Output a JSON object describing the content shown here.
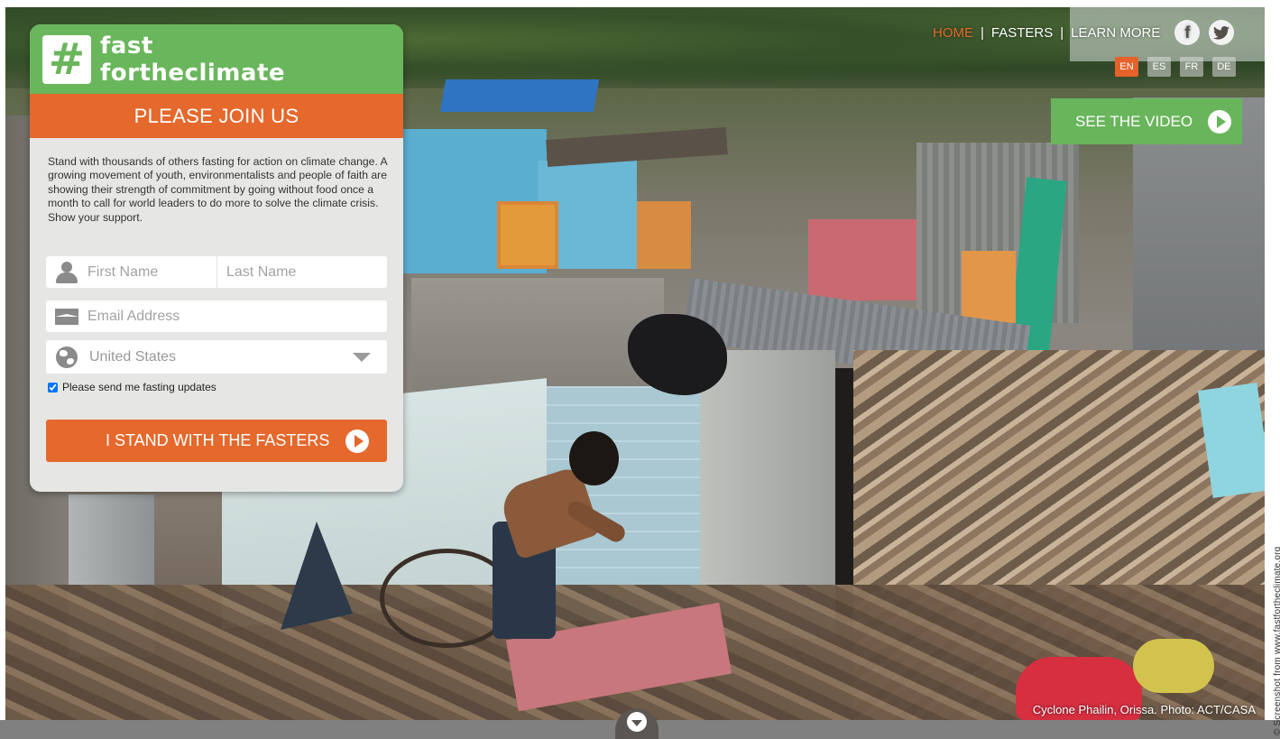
{
  "brand": {
    "line1": "fast",
    "line2": "fortheclimate",
    "icon": "hash-icon"
  },
  "signup": {
    "heading": "PLEASE JOIN US",
    "intro": "Stand with thousands of others fasting for action on climate change. A growing movement of youth, environmentalists and people of faith are showing their strength of commitment by going without food once a month to call for world leaders to do more to solve the climate crisis. Show your support.",
    "first_name_placeholder": "First Name",
    "last_name_placeholder": "Last Name",
    "email_placeholder": "Email Address",
    "country_value": "United States",
    "updates_label": "Please send me fasting updates",
    "updates_checked": true,
    "submit_label": "I STAND WITH THE FASTERS"
  },
  "nav": {
    "items": [
      {
        "label": "HOME",
        "active": true
      },
      {
        "label": "FASTERS",
        "active": false
      },
      {
        "label": "LEARN MORE",
        "active": false
      }
    ],
    "social": [
      {
        "icon": "facebook-icon",
        "glyph": "f"
      },
      {
        "icon": "twitter-icon",
        "glyph": "t"
      }
    ],
    "languages": [
      {
        "code": "EN",
        "active": true
      },
      {
        "code": "ES",
        "active": false
      },
      {
        "code": "FR",
        "active": false
      },
      {
        "code": "DE",
        "active": false
      }
    ]
  },
  "video_button": {
    "label": "SEE THE VIDEO"
  },
  "caption": "Cyclone Phailin, Orissa. Photo: ACT/CASA",
  "credit": "© Screenshot from www.fastfortheclimate.org",
  "colors": {
    "green": "#6ab65c",
    "orange": "#e5682c",
    "panel": "#e6e6e4"
  }
}
